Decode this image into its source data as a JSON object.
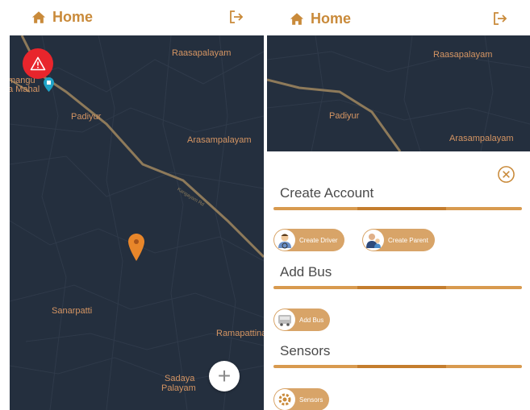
{
  "left_screen": {
    "header": {
      "title": "Home",
      "home_icon": "home-icon",
      "logout_icon": "logout-icon"
    },
    "map": {
      "places": {
        "raasapalayam": "Raasapalayam",
        "manga_line1": "mangu",
        "manga_line2": "a Mahal",
        "padiyur": "Padiyur",
        "arasampalayam": "Arasampalayam",
        "road": "Kangayam Rd",
        "sanarpatti": "Sanarpatti",
        "ramapattina": "Ramapattina",
        "sadaya_line1": "Sadaya",
        "sadaya_line2": "Palayam"
      }
    },
    "fab_symbol": "+"
  },
  "right_screen": {
    "header": {
      "title": "Home"
    },
    "map": {
      "places": {
        "raasapalayam": "Raasapalayam",
        "padiyur": "Padiyur",
        "arasampalayam": "Arasampalayam"
      }
    },
    "sheet": {
      "create_account": {
        "title": "Create Account",
        "buttons": {
          "create_driver": "Create Driver",
          "create_parent": "Create Parent"
        }
      },
      "add_bus": {
        "title": "Add Bus",
        "buttons": {
          "add_bus": "Add Bus"
        }
      },
      "sensors": {
        "title": "Sensors",
        "buttons": {
          "sensors": "Sensors"
        }
      }
    }
  },
  "colors": {
    "accent": "#c98a3a",
    "map_bg": "#242f3e",
    "map_label": "#d59563",
    "alert": "#e8252c",
    "pin": "#e8862a"
  }
}
